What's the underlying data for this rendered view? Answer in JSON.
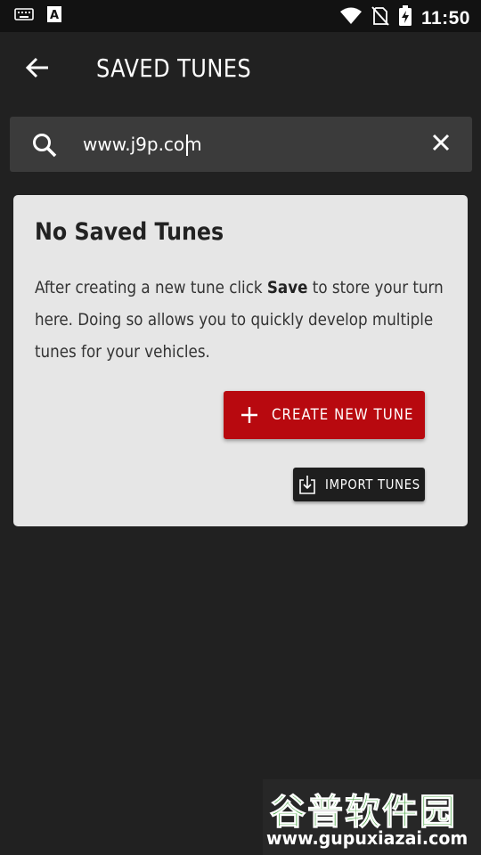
{
  "status_bar": {
    "time": "11:50",
    "icons": [
      "keyboard-icon",
      "a-badge-icon",
      "wifi-icon",
      "no-sim-icon",
      "battery-charging-icon"
    ]
  },
  "app_bar": {
    "title": "SAVED TUNES",
    "back_icon": "arrow-left-icon"
  },
  "search": {
    "value": "www.j9p.com",
    "search_icon": "search-icon",
    "clear_icon": "close-icon"
  },
  "card": {
    "title": "No Saved Tunes",
    "body_before": "After creating a new tune click ",
    "body_bold": "Save",
    "body_after": " to store your turn here. Doing so allows you to quickly develop multiple tunes for your vehicles.",
    "create_button_label": "CREATE NEW TUNE",
    "import_button_label": "IMPORT TUNES"
  },
  "colors": {
    "background": "#212121",
    "status_bar": "#121212",
    "search_bg": "#3b3b3b",
    "card_bg": "#e6e6e6",
    "accent_red": "#b8090f",
    "dark_button": "#1e1e1e"
  },
  "watermark": {
    "text_cn": "谷普软件园",
    "url": "www.gupuxiazai.com"
  }
}
